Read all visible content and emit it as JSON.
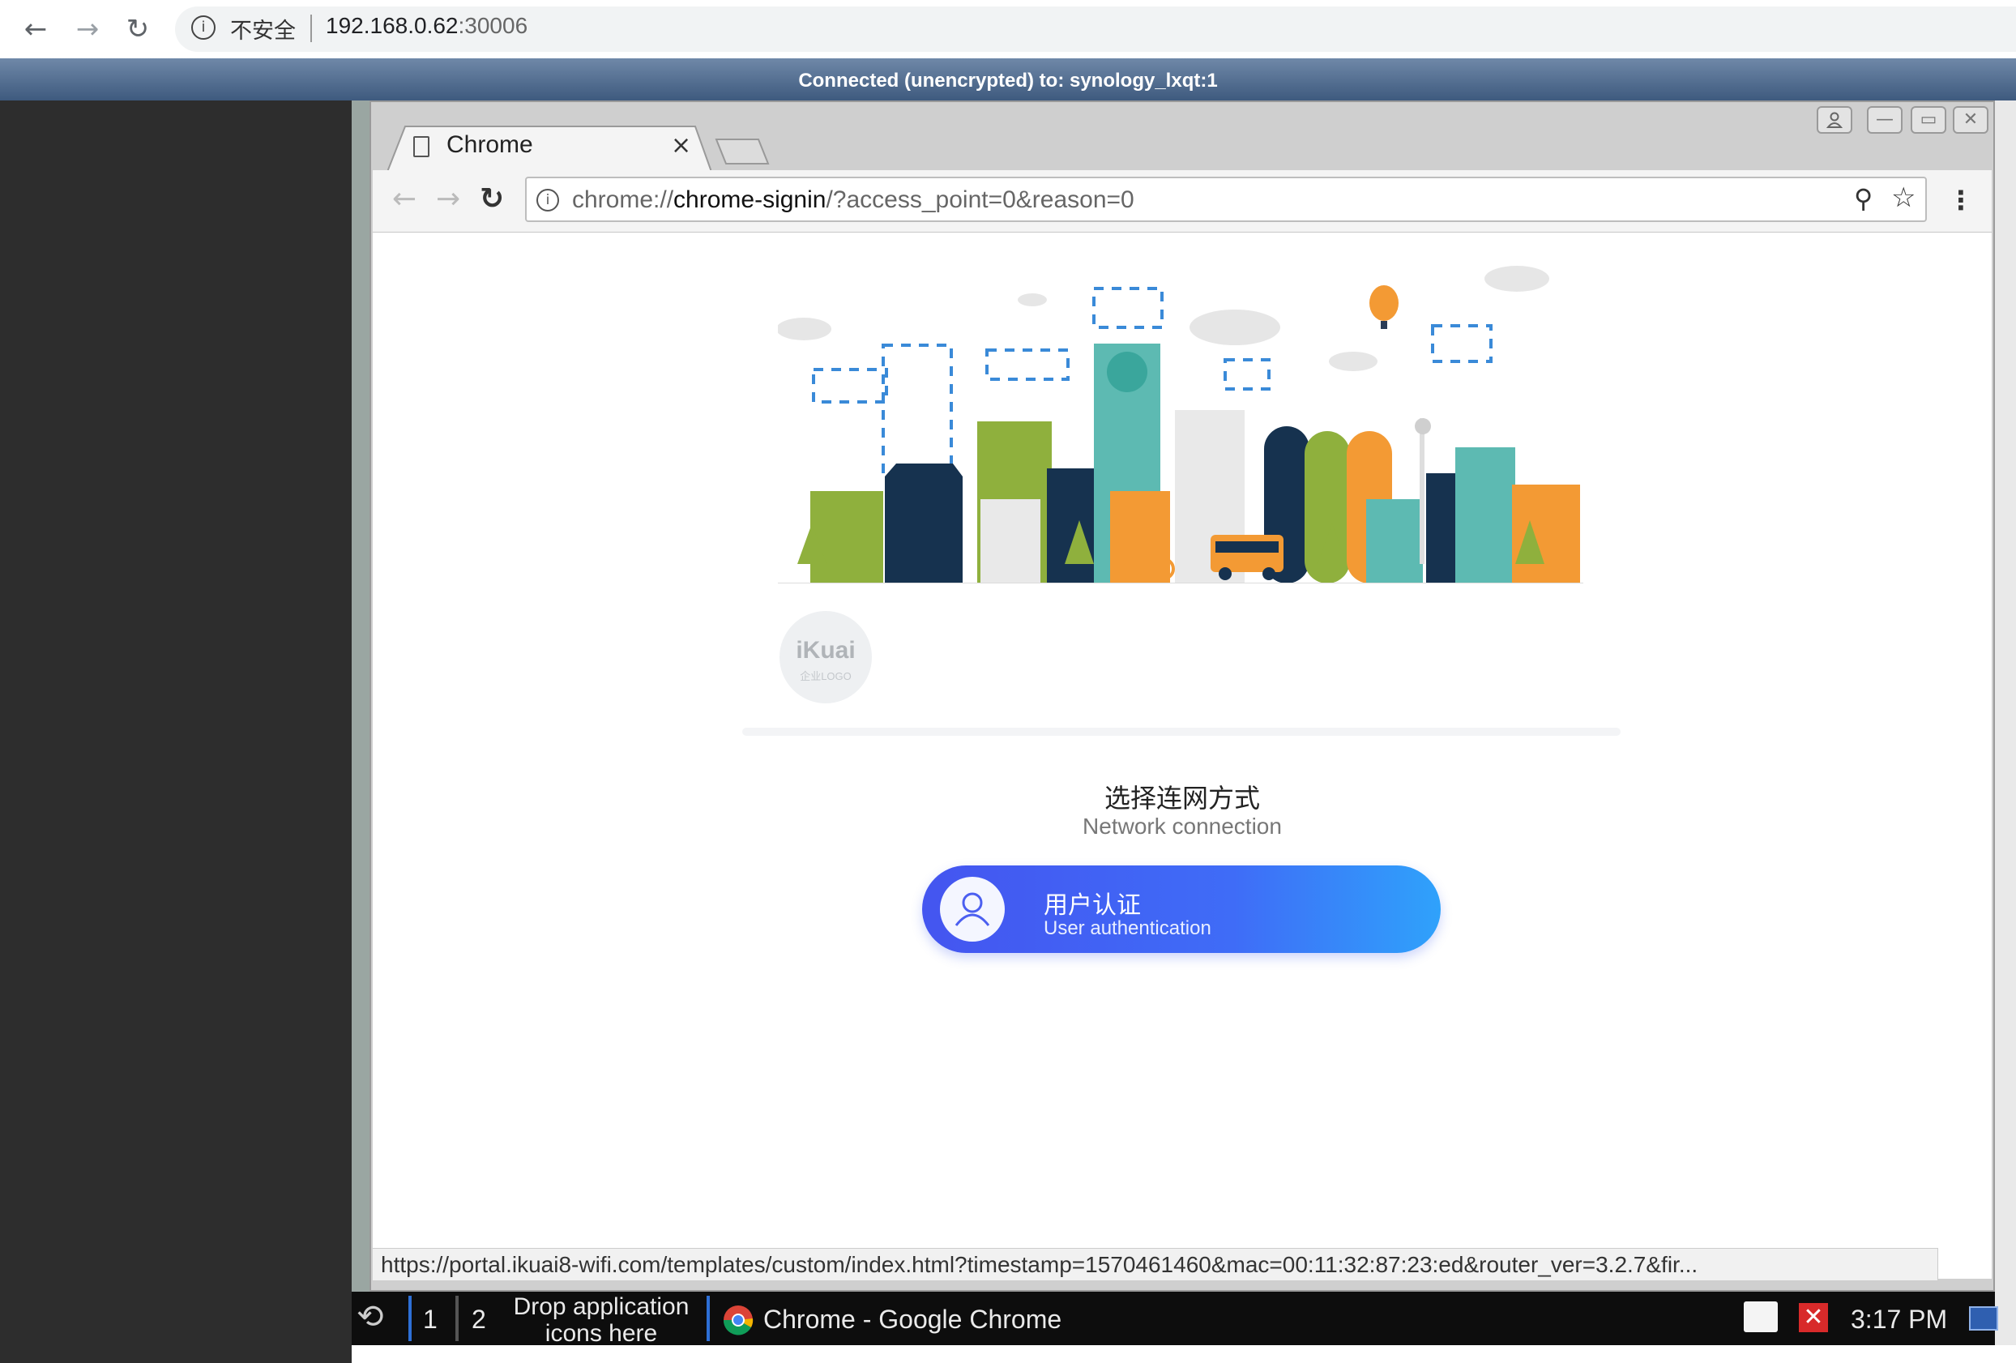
{
  "outer_browser": {
    "back_icon": "arrow-left-icon",
    "forward_icon": "arrow-right-icon",
    "reload_icon": "reload-icon",
    "security_label": "不安全",
    "url_host": "192.168.0.62",
    "url_port": ":30006"
  },
  "vnc": {
    "status": "Connected (unencrypted) to: synology_lxqt:1"
  },
  "inner_window": {
    "tab_title": "Chrome",
    "tab_close": "×",
    "address_prefix": "chrome://",
    "address_host": "chrome-signin",
    "address_path": "/?access_point=0&reason=0",
    "status_url": "https://portal.ikuai8-wifi.com/templates/custom/index.html?timestamp=1570461460&mac=00:11:32:87:23:ed&router_ver=3.2.7&fir..."
  },
  "page": {
    "logo_text": "iKuai",
    "logo_subtext": "企业LOGO",
    "heading_cn": "选择连网方式",
    "heading_en": "Network connection",
    "auth_button_cn": "用户认证",
    "auth_button_en": "User authentication"
  },
  "taskbar": {
    "workspace_1": "1",
    "workspace_2": "2",
    "drop_hint_line1": "Drop application",
    "drop_hint_line2": "icons here",
    "window_label": "Chrome - Google Chrome",
    "clock": "3:17 PM"
  },
  "colors": {
    "vnc_bar": "#4a6890",
    "button_gradient_start": "#4455f0",
    "button_gradient_end": "#2fa2fb",
    "taskbar": "#0d0d0d"
  }
}
